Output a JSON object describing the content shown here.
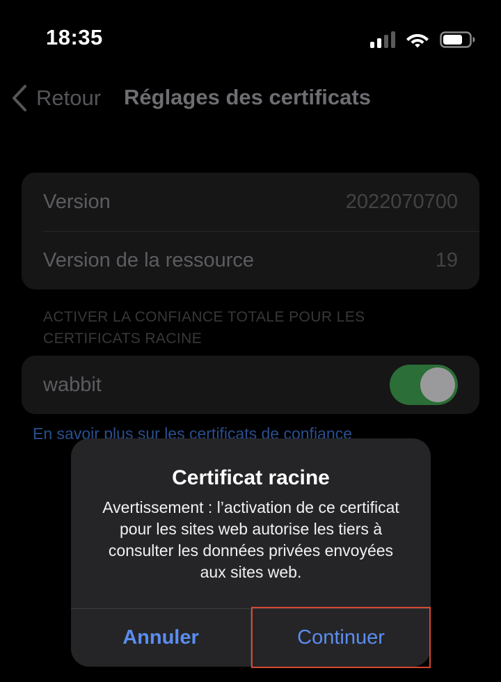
{
  "status_bar": {
    "time": "18:35",
    "icons": [
      "cellular-signal-icon",
      "wifi-icon",
      "battery-icon"
    ]
  },
  "nav": {
    "back_label": "Retour",
    "back_icon": "chevron-left-icon",
    "title": "Réglages des certificats"
  },
  "info_rows": [
    {
      "label": "Version",
      "value": "2022070700"
    },
    {
      "label": "Version de la ressource",
      "value": "19"
    }
  ],
  "trust_section": {
    "header": "ACTIVER LA CONFIANCE TOTALE POUR LES CERTIFICATS RACINE",
    "certificate_name": "wabbit",
    "toggle_on": true,
    "learn_more": "En savoir plus sur les certificats de confiance"
  },
  "alert": {
    "title": "Certificat racine",
    "message": "Avertissement : l’activation de ce certificat pour les sites web autorise les tiers à consulter les données privées envoyées aux sites web.",
    "cancel_label": "Annuler",
    "continue_label": "Continuer"
  },
  "colors": {
    "background": "#000000",
    "alert_background": "#252527",
    "accent": "#5b8df0",
    "toggle_on": "#2c6e37",
    "highlight": "#d44832"
  }
}
